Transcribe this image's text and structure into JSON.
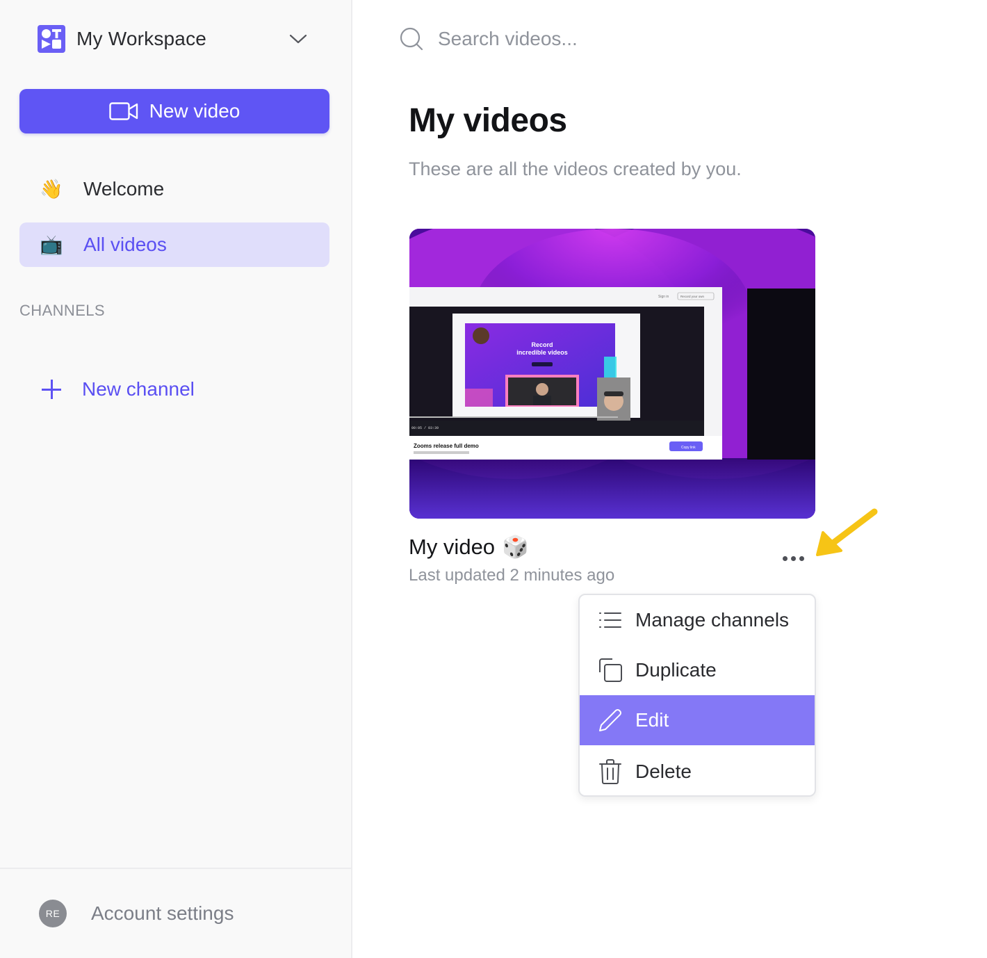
{
  "sidebar": {
    "workspace_name": "My Workspace",
    "new_video_label": "New video",
    "nav": [
      {
        "emoji": "👋",
        "label": "Welcome"
      },
      {
        "emoji": "📺",
        "label": "All videos"
      }
    ],
    "channels_heading": "CHANNELS",
    "new_channel_label": "New channel",
    "account": {
      "initials": "RE",
      "label": "Account settings"
    }
  },
  "search": {
    "placeholder": "Search videos..."
  },
  "main": {
    "title": "My videos",
    "subtitle": "These are all the videos created by you.",
    "videos": [
      {
        "title": "My video",
        "title_emoji": "🎲",
        "meta": "Last updated 2 minutes ago",
        "thumbnail_texts": {
          "heading_1": "Record",
          "heading_2": "incredible videos",
          "caption": "Zooms release full demo",
          "time": "00:05 / 03:39",
          "copy_link": "Copy link",
          "sign_in": "Sign in",
          "record_own": "Record your own"
        }
      }
    ]
  },
  "context_menu": {
    "items": [
      {
        "label": "Manage channels",
        "icon": "list-icon"
      },
      {
        "label": "Duplicate",
        "icon": "duplicate-icon"
      },
      {
        "label": "Edit",
        "icon": "pencil-icon",
        "highlighted": true
      },
      {
        "label": "Delete",
        "icon": "trash-icon"
      }
    ]
  },
  "colors": {
    "accent": "#5f55f4",
    "nav_active_bg": "#e0defb",
    "menu_highlight": "#8478f6",
    "annotation_arrow": "#f6c416"
  }
}
